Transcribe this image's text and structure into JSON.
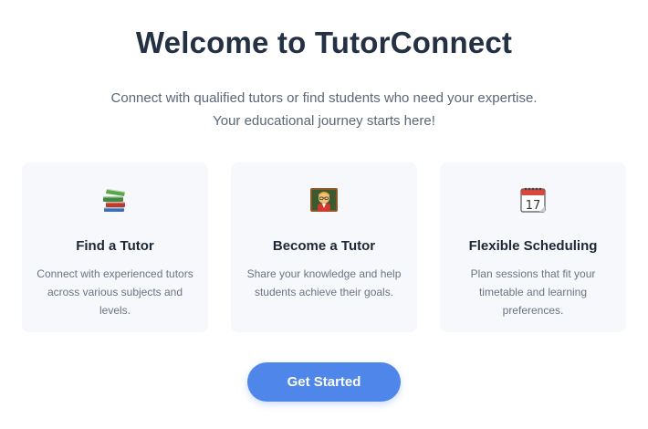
{
  "header": {
    "title": "Welcome to TutorConnect",
    "subtitle_line1": "Connect with qualified tutors or find students who need your expertise.",
    "subtitle_line2": "Your educational journey starts here!"
  },
  "cards": [
    {
      "icon": "books-icon",
      "title": "Find a Tutor",
      "description": "Connect with experienced tutors across various subjects and levels."
    },
    {
      "icon": "teacher-icon",
      "title": "Become a Tutor",
      "description": "Share your knowledge and help students achieve their goals."
    },
    {
      "icon": "calendar-icon",
      "title": "Flexible Scheduling",
      "description": "Plan sessions that fit your timetable and learning preferences."
    }
  ],
  "cta": {
    "label": "Get Started"
  },
  "colors": {
    "accent": "#4f86ea",
    "heading": "#243044",
    "card_bg": "#f6f8fb"
  }
}
